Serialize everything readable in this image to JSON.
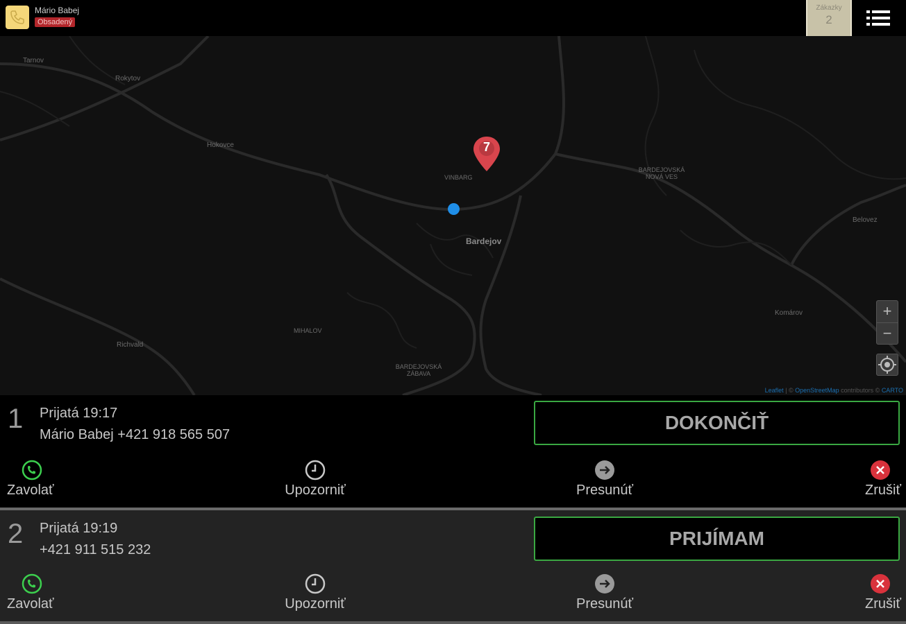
{
  "header": {
    "user_name": "Mário Babej",
    "status": "Obsadený",
    "orders_label": "Zákazky",
    "orders_count": "2"
  },
  "map": {
    "places": [
      {
        "id": "tarnov",
        "label": "Tarnov"
      },
      {
        "id": "rokytov",
        "label": "Rokytov"
      },
      {
        "id": "hokovce",
        "label": "Hokovce"
      },
      {
        "id": "vinbarg",
        "label": "VINBARG"
      },
      {
        "id": "bardejov",
        "label": "Bardejov"
      },
      {
        "id": "nova-ves",
        "label": "BARDEJOVSKÁ NOVÁ VES"
      },
      {
        "id": "belovez",
        "label": "Belovez"
      },
      {
        "id": "mihalov",
        "label": "MIHALOV"
      },
      {
        "id": "richvald",
        "label": "Richvald"
      },
      {
        "id": "zabava",
        "label": "BARDEJOVSKÁ ZÁBAVA"
      },
      {
        "id": "komarov",
        "label": "Komárov"
      }
    ],
    "marker_label": "7",
    "zoom_in": "+",
    "zoom_out": "−",
    "attribution": {
      "leaflet": "Leaflet",
      "sep1": " | © ",
      "osm": "OpenStreetMap",
      "contrib": " contributors © ",
      "carto": "CARTO"
    }
  },
  "orders": [
    {
      "number": "1",
      "time": "Prijatá 19:17",
      "contact": "Mário Babej +421 918 565 507",
      "main_action": "DOKONČIŤ",
      "actions": {
        "call": "Zavolať",
        "notify": "Upozorniť",
        "move": "Presunúť",
        "cancel": "Zrušiť"
      }
    },
    {
      "number": "2",
      "time": "Prijatá 19:19",
      "contact": "+421 911 515 232",
      "main_action": "PRIJÍMAM",
      "actions": {
        "call": "Zavolať",
        "notify": "Upozorniť",
        "move": "Presunúť",
        "cancel": "Zrušiť"
      }
    }
  ],
  "colors": {
    "accent_green": "#3aa842",
    "status_red": "#b3262b",
    "marker_red": "#d9454d",
    "location_blue": "#1f8ee8"
  }
}
